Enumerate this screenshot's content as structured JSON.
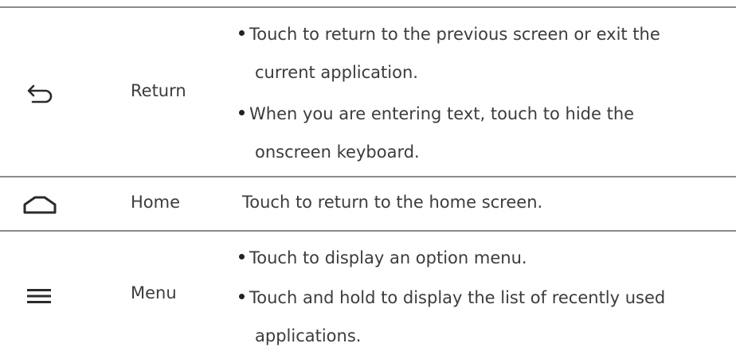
{
  "rows": [
    {
      "icon": "back-arrow-icon",
      "label": "Return",
      "bullets": [
        {
          "line1": "Touch to return to the previous screen or exit the",
          "line2": "current application."
        },
        {
          "line1": "When you are entering text, touch to hide the",
          "line2": "onscreen keyboard."
        }
      ]
    },
    {
      "icon": "home-icon",
      "label": "Home",
      "text": "Touch to return to the home screen."
    },
    {
      "icon": "menu-icon",
      "label": "Menu",
      "bullets": [
        {
          "line1": "Touch to display an option menu."
        },
        {
          "line1": "Touch and hold to display the list of recently used",
          "line2": "applications."
        }
      ]
    }
  ]
}
